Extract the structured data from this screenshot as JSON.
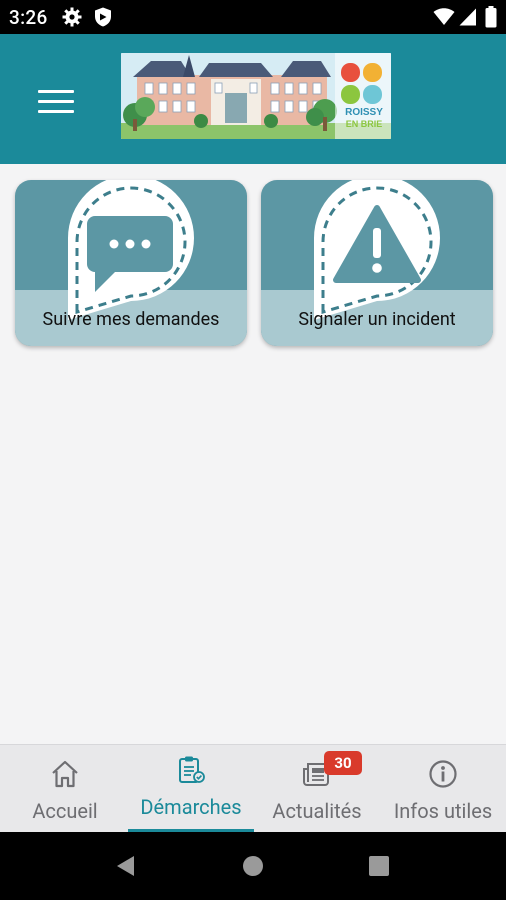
{
  "status_bar": {
    "time": "3:26",
    "left_icons": [
      "settings-icon",
      "shield-icon"
    ],
    "right_icons": [
      "wifi-icon",
      "signal-icon",
      "battery-icon"
    ]
  },
  "app_bar": {
    "menu_icon": "hamburger-menu-icon",
    "logo": {
      "line1": "ROISSY",
      "line2": "EN BRIE"
    }
  },
  "cards": [
    {
      "label": "Suivre mes demandes",
      "icon": "chat-bubble-icon"
    },
    {
      "label": "Signaler un incident",
      "icon": "warning-triangle-icon"
    }
  ],
  "bottom_nav": {
    "items": [
      {
        "label": "Accueil",
        "icon": "home-icon",
        "active": false
      },
      {
        "label": "Démarches",
        "icon": "clipboard-icon",
        "active": true
      },
      {
        "label": "Actualités",
        "icon": "newspaper-icon",
        "active": false,
        "badge": "30"
      },
      {
        "label": "Infos utiles",
        "icon": "info-icon",
        "active": false
      }
    ]
  },
  "system_nav": [
    "back-icon",
    "home-circle-icon",
    "recents-icon"
  ],
  "colors": {
    "primary": "#1b8a9a",
    "card_top": "#5c97a4",
    "card_bottom": "#a9c9d0",
    "badge": "#d93a2b",
    "background": "#f4f4f5"
  }
}
